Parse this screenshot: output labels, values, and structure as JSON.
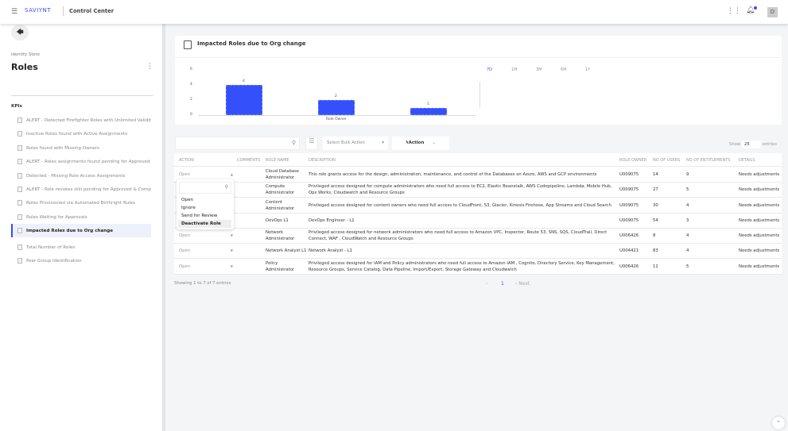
{
  "header": {
    "brand": "SAVIYNT",
    "app_title": "Control Center",
    "avatar_initial": "D"
  },
  "sidebar": {
    "breadcrumb": "Identity Store",
    "title": "Roles",
    "section": "KPIs",
    "items": [
      {
        "label": "ALERT - Detected Firefighter Roles with Unlimited Validity"
      },
      {
        "label": "Inactive Roles found with Active Assignments"
      },
      {
        "label": "Roles found with Missing Owners"
      },
      {
        "label": "ALERT - Roles assignments found pending for Approved ..."
      },
      {
        "label": "Detected - Missing Role Access Assignments"
      },
      {
        "label": "ALERT - Role revokes still pending for Approved & Compl..."
      },
      {
        "label": "Roles Provisioned via Automated Birthright Rules"
      },
      {
        "label": "Roles Waiting for Approvals"
      },
      {
        "label": "Impacted Roles due to Org change",
        "active": true
      },
      {
        "label": "Total Number of Roles"
      },
      {
        "label": "Peer Group Identification"
      }
    ]
  },
  "chart_card": {
    "title": "Impacted Roles due to Org change",
    "time_filters": [
      "7D",
      "1M",
      "3M",
      "6M",
      "1Y"
    ],
    "active_filter": "7D"
  },
  "chart_data": {
    "type": "bar",
    "xlabel": "Role Owner",
    "values": [
      4,
      2,
      1
    ],
    "data_labels": [
      "4",
      "2",
      "1"
    ],
    "ylim": [
      0,
      6
    ],
    "yticks": [
      "0",
      "2",
      "4",
      "6"
    ],
    "grid": false,
    "bar_color": "#3450fb"
  },
  "toolbar": {
    "search_placeholder": "",
    "bulk_action": "Select Bulk Action",
    "action_label": "Action",
    "show_label": "Show",
    "page_size": "25",
    "entries_label": "entries"
  },
  "table": {
    "columns": [
      "ACTION",
      "COMMENTS",
      "ROLE NAME",
      "DESCRIPTION",
      "ROLE OWNER",
      "NO OF USERS",
      "NO OF ENTITLEMENTS",
      "DETAILS"
    ],
    "rows": [
      {
        "action": "Open",
        "role": "Cloud Database Administrator",
        "desc": "This role grants access for the design, administration, maintenance, and control of the Databases on Azure, AWS and GCP environments",
        "owner": "U009075",
        "users": "14",
        "ents": "9",
        "details": "Needs adjustments"
      },
      {
        "action": "Open",
        "role": "Compute Administrator",
        "desc": "Privileged access designed for compute administrators who need full access to EC2, Elastic Beanstalk, AWS Codepipeline, Lambda, Mobile Hub, Ops Works, Cloudwatch and Resource Groups",
        "owner": "U009075",
        "users": "27",
        "ents": "5",
        "details": "Needs adjustments"
      },
      {
        "action": "Open",
        "role": "Content Administrator",
        "desc": "Privileged access designed for content owners who need full access to CloudFront, S3, Glacier, Kinesis Firehose, App Streams and Cloud Search",
        "owner": "U009075",
        "users": "30",
        "ents": "4",
        "details": "Needs adjustments"
      },
      {
        "action": "Open",
        "role": "DevOps L1",
        "desc": "DevOps Engineer - L1",
        "owner": "U009075",
        "users": "54",
        "ents": "3",
        "details": "Needs adjustments"
      },
      {
        "action": "Open",
        "role": "Network Administrator",
        "desc": "Privileged access designed for network administrators who need full access to Amazon VPC, Inspector, Route 53, SNS, SQS, CloudTrail, Direct Connect, WAF , CloudWatch and Resource Groups",
        "owner": "U006426",
        "users": "8",
        "ents": "4",
        "details": "Needs adjustments"
      },
      {
        "action": "Open",
        "role": "Network Analyst L1",
        "desc": "Network Analyst - L1",
        "owner": "U004421",
        "users": "83",
        "ents": "4",
        "details": "Needs adjustments"
      },
      {
        "action": "Open",
        "role": "Policy Administrator",
        "desc": "Privileged access designed for IAM and Policy administrators who need full access to Amazon IAM , Cognito, Directory Service, Key Management, Resource Groups, Service Catalog, Data Pipeline, Import/Export, Storage Gateway and Cloudwatch",
        "owner": "U006426",
        "users": "11",
        "ents": "5",
        "details": "Needs adjustments"
      }
    ]
  },
  "dropdown": {
    "options": [
      "Open",
      "Ignore",
      "Send for Review",
      "Deactivate Role"
    ],
    "highlighted": "Deactivate Role"
  },
  "footer": {
    "showing": "Showing 1 to 7 of 7 entries",
    "prev": "‹",
    "page": "1",
    "next": "› Next"
  }
}
